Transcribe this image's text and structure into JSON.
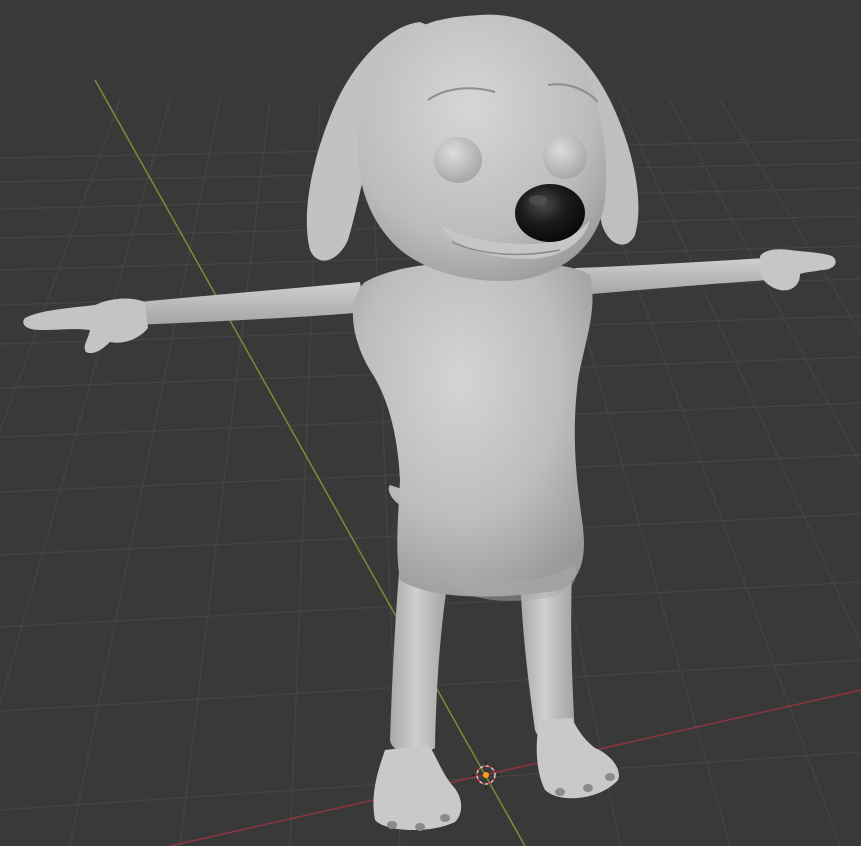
{
  "viewport": {
    "mode": "3d-viewport",
    "shading": "solid",
    "background_color": "#393939",
    "grid_color": "#4a4a4a",
    "axis_y_color": "#8b9a3a",
    "axis_x_color": "#9a3a44"
  },
  "scene": {
    "object": "cartoon-dog-model",
    "pose": "t-pose",
    "material_color": "#c8c8c8",
    "nose_color": "#1a1a1a",
    "has_3d_cursor": true
  }
}
